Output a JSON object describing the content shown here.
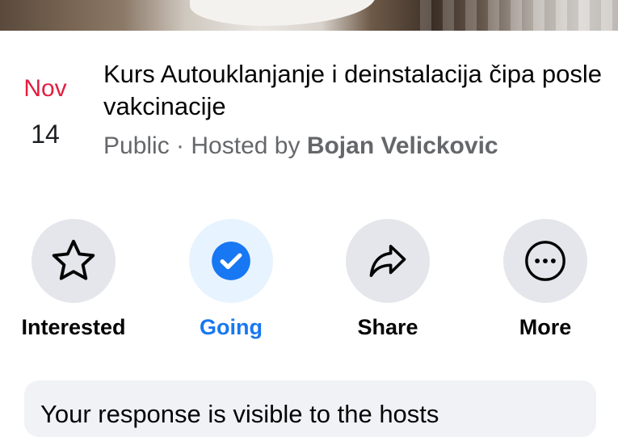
{
  "event": {
    "month": "Nov",
    "day": "14",
    "title": "Kurs Autouklanjanje i deinstalacija čipa posle vakcinacije",
    "privacy": "Public",
    "separator": " · ",
    "hosted_by_prefix": "Hosted by ",
    "host_name": "Bojan Velickovic"
  },
  "actions": {
    "interested": {
      "label": "Interested",
      "icon": "star-icon"
    },
    "going": {
      "label": "Going",
      "icon": "check-circle-icon"
    },
    "share": {
      "label": "Share",
      "icon": "share-arrow-icon"
    },
    "more": {
      "label": "More",
      "icon": "more-dots-icon"
    }
  },
  "notice": {
    "text": "Your response is visible to the hosts"
  },
  "colors": {
    "date_month": "#e41e3f",
    "going_accent": "#1877f2",
    "action_circle": "#e4e6eb",
    "going_circle": "#e7f3ff",
    "notice_bg": "#f0f2f5"
  }
}
